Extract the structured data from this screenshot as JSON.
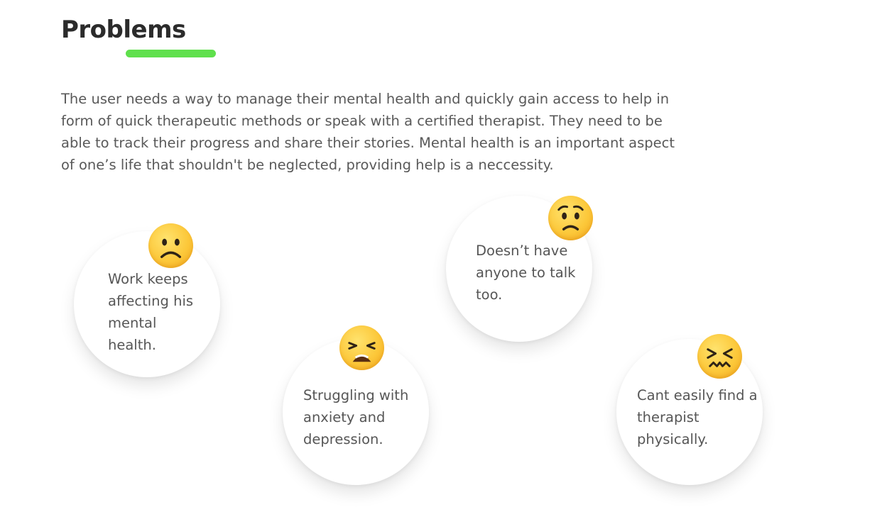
{
  "section": {
    "title": "Problems",
    "description": "The user needs a way to manage their mental health and quickly gain access to help in form of quick therapeutic methods or speak with a certified therapist. They need to be able to track their progress and share their stories. Mental health is an important aspect of one’s life that shouldn't be neglected, providing help is a neccessity.",
    "accent_color": "#5fe04c"
  },
  "problems": [
    {
      "text": "Work keeps affecting his mental health.",
      "icon": "frowning-face-icon"
    },
    {
      "text": "Doesn’t have anyone to talk too.",
      "icon": "worried-face-icon"
    },
    {
      "text": "Struggling with anxiety and depression.",
      "icon": "weary-face-icon"
    },
    {
      "text": "Cant easily find a therapist physically.",
      "icon": "confounded-face-icon"
    }
  ]
}
